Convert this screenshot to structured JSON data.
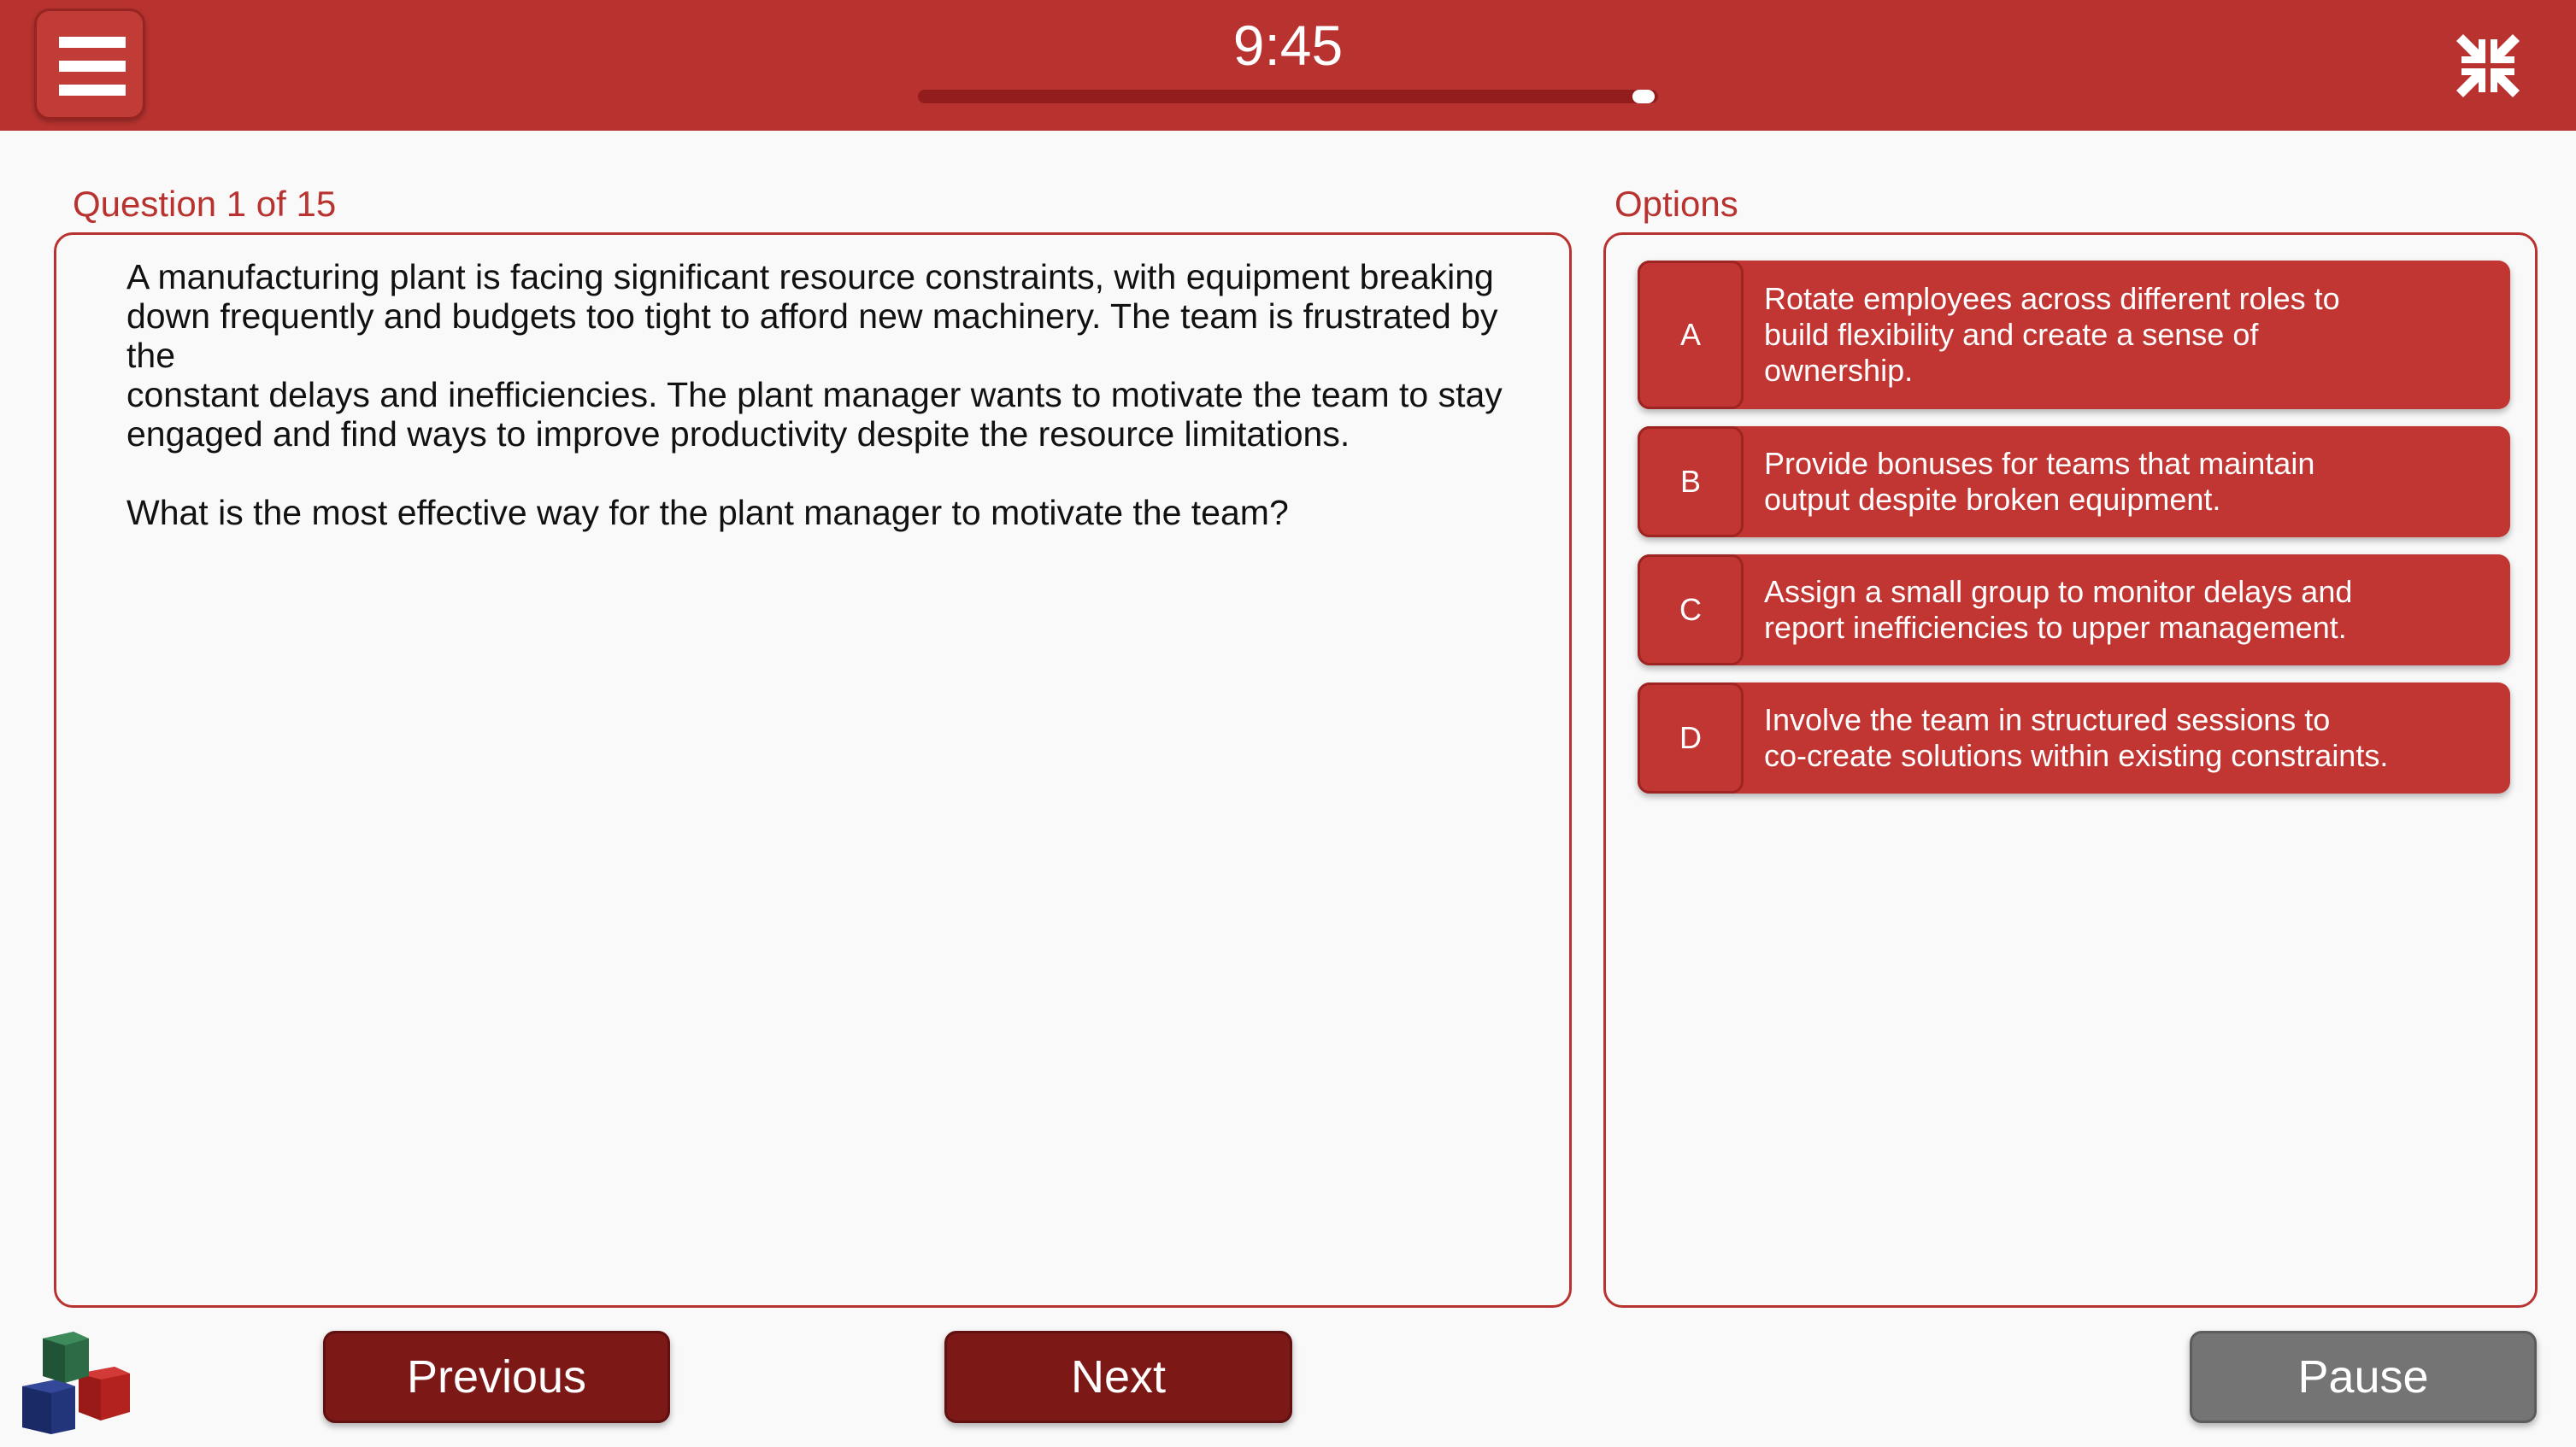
{
  "header": {
    "timer": "9:45",
    "timer_progress": 0.98,
    "menu_icon": "hamburger-menu-icon",
    "collapse_icon": "collapse-arrows-icon"
  },
  "question": {
    "counter": "Question 1 of 15",
    "scenario_lines": [
      "A manufacturing plant is facing significant resource constraints, with equipment breaking",
      "down frequently and budgets too tight to afford new machinery. The team is frustrated by the",
      "constant delays and inefficiencies. The plant manager wants to motivate the team to stay",
      "engaged and find ways to improve productivity despite the resource limitations."
    ],
    "prompt": "What is the most effective way for the plant manager to motivate the team?"
  },
  "options": {
    "label": "Options",
    "items": [
      {
        "letter": "A",
        "lines": [
          "Rotate employees across different roles to",
          "build flexibility and create a sense of",
          "ownership."
        ]
      },
      {
        "letter": "B",
        "lines": [
          "Provide bonuses for teams that maintain",
          "output despite broken equipment."
        ]
      },
      {
        "letter": "C",
        "lines": [
          "Assign a small group to monitor delays and",
          "report inefficiencies to upper management."
        ]
      },
      {
        "letter": "D",
        "lines": [
          "Involve the team in structured sessions to",
          "co-create solutions within existing constraints."
        ]
      }
    ]
  },
  "footer": {
    "previous_label": "Previous",
    "next_label": "Next",
    "pause_label": "Pause",
    "logo_icon": "stacked-cubes-logo-icon"
  },
  "colors": {
    "brand_red": "#b83330",
    "dark_red": "#7c1816",
    "pause_gray": "#747474",
    "background": "#f9f9f9"
  }
}
